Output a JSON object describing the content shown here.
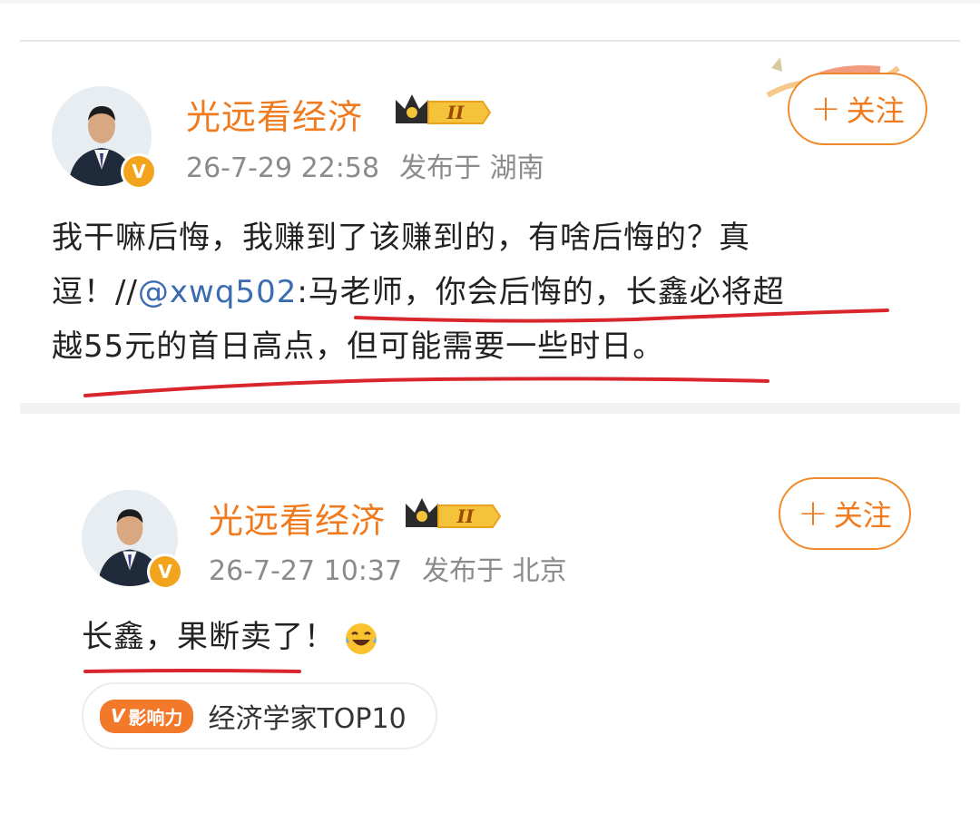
{
  "colors": {
    "name": "#f07a1e",
    "mention": "#3b6cb1",
    "meta": "#8b8b8b",
    "underline": "#d9262c",
    "follow_border": "#f08a2a"
  },
  "post1": {
    "author": "光远看经济",
    "level_badge": "II",
    "timestamp": "26-7-29 22:58",
    "location": "发布于 湖南",
    "follow_label": "关注",
    "text_line1": "我干嘛后悔，我赚到了该赚到的，有啥后悔的？真",
    "text_line2_pre": "逗！//",
    "text_line2_mention": "@xwq502",
    "text_line2_post": ":马老师，你会后悔的，长鑫必将超",
    "text_line3": "越55元的首日高点，但可能需要一些时日。"
  },
  "post2": {
    "author": "光远看经济",
    "level_badge": "II",
    "timestamp": "26-7-27 10:37",
    "location": "发布于 北京",
    "follow_label": "关注",
    "text": "长鑫，果断卖了！",
    "emoji": "laughing-tears-emoji",
    "tag_badge": "影响力",
    "tag_badge_v": "V",
    "tag_text": "经济学家TOP10"
  }
}
